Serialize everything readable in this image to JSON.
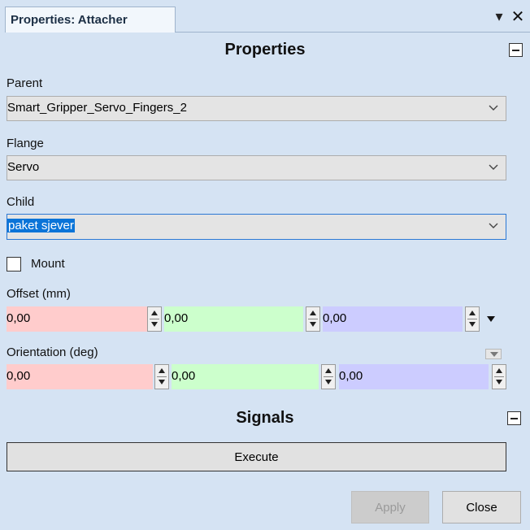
{
  "window": {
    "tab_title": "Properties: Attacher",
    "pin_glyph": "▾",
    "close_glyph": "✕"
  },
  "properties": {
    "section_title": "Properties",
    "parent": {
      "label": "Parent",
      "value": "Smart_Gripper_Servo_Fingers_2"
    },
    "flange": {
      "label": "Flange",
      "value": "Servo"
    },
    "child": {
      "label": "Child",
      "value": "paket sjever"
    },
    "mount": {
      "label": "Mount",
      "checked": false
    },
    "offset": {
      "label": "Offset (mm)",
      "x": "0,00",
      "y": "0,00",
      "z": "0,00"
    },
    "orientation": {
      "label": "Orientation (deg)",
      "x": "0,00",
      "y": "0,00",
      "z": "0,00"
    }
  },
  "signals": {
    "section_title": "Signals",
    "execute_label": "Execute"
  },
  "footer": {
    "apply_label": "Apply",
    "close_label": "Close"
  },
  "colors": {
    "background": "#d5e3f3",
    "x_axis_field": "#ffcccc",
    "y_axis_field": "#ccffcc",
    "z_axis_field": "#ccccff",
    "selection": "#0a74d8"
  }
}
